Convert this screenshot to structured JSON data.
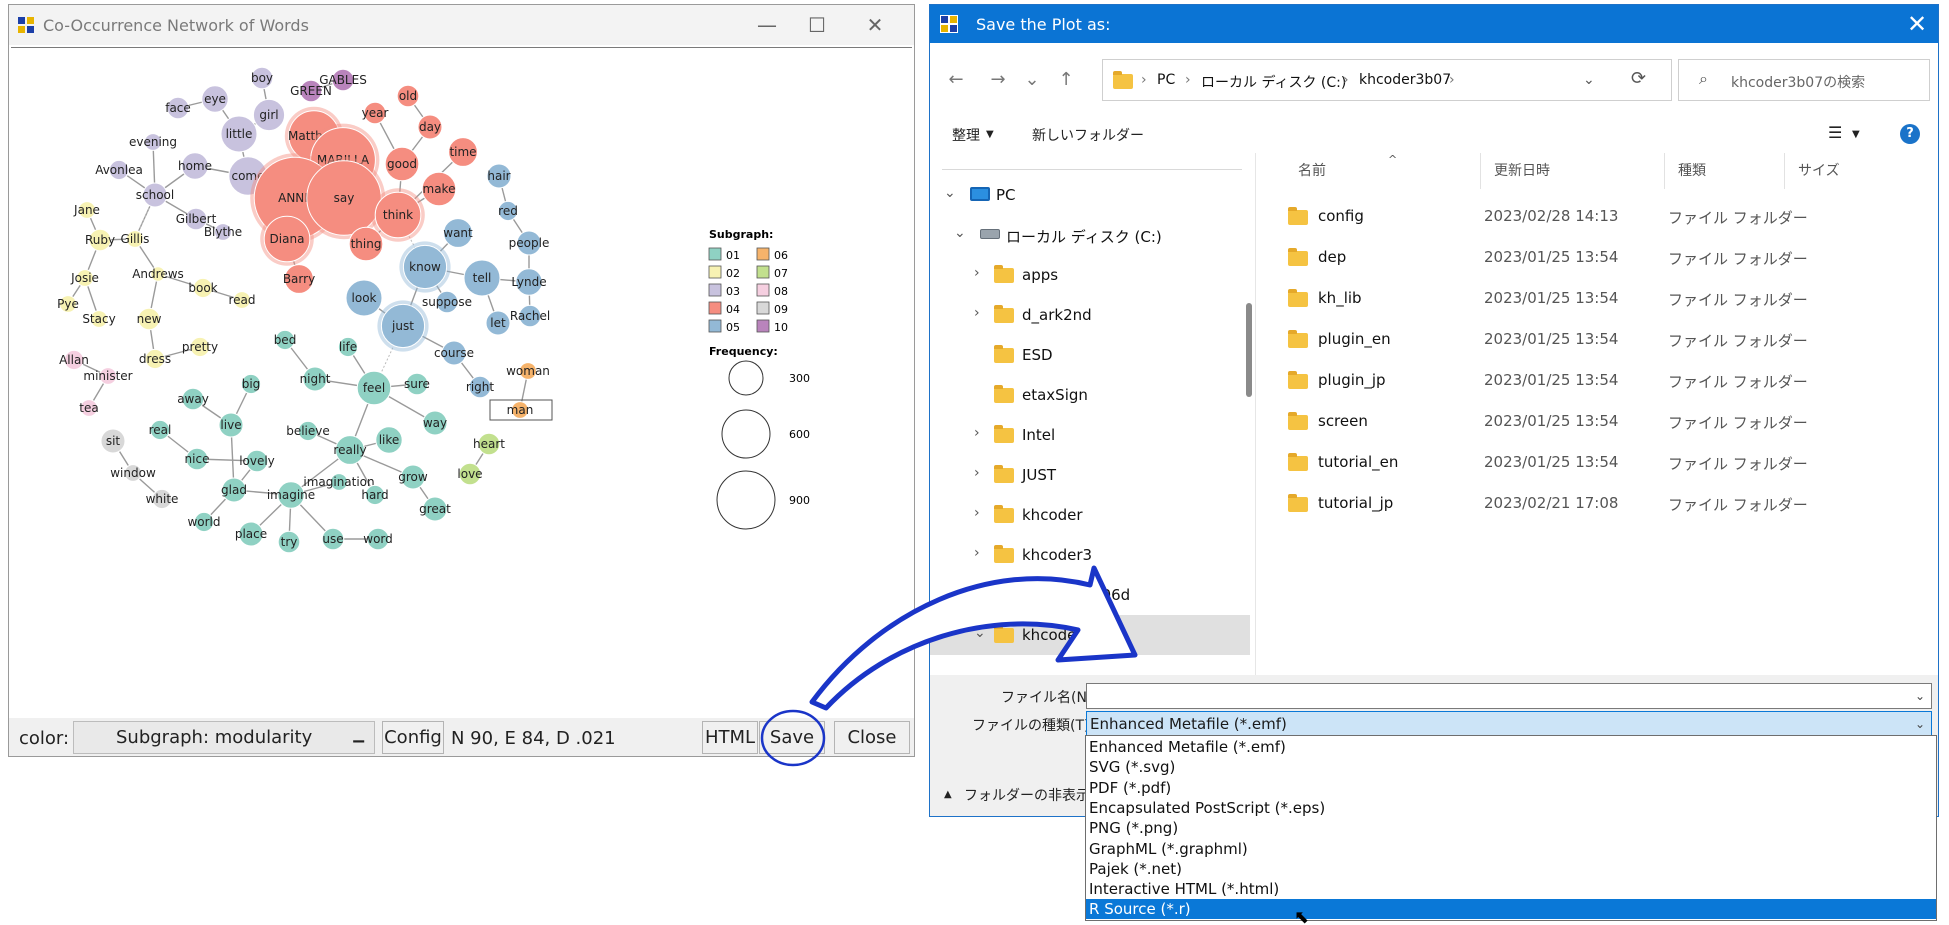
{
  "network_window": {
    "title": "Co-Occurrence Network of Words",
    "controls": {
      "minimize": "—",
      "maximize": "☐",
      "close": "✕"
    },
    "legend": {
      "subgraph_title": "Subgraph:",
      "subgraphs": [
        {
          "label": "01",
          "color": "#8fd1c3"
        },
        {
          "label": "02",
          "color": "#f7f2b3"
        },
        {
          "label": "03",
          "color": "#c8c2de"
        },
        {
          "label": "04",
          "color": "#f58d80"
        },
        {
          "label": "05",
          "color": "#93b9d6"
        },
        {
          "label": "06",
          "color": "#f6b36b"
        },
        {
          "label": "07",
          "color": "#c2e08e"
        },
        {
          "label": "08",
          "color": "#f5cfe0"
        },
        {
          "label": "09",
          "color": "#d8d8d8"
        },
        {
          "label": "10",
          "color": "#b984bc"
        }
      ],
      "frequency_title": "Frequency:",
      "frequency_values": [
        "300",
        "600",
        "900"
      ]
    },
    "toolbar": {
      "color_label": "color:",
      "color_select": "Subgraph: modularity",
      "config_label": "Config",
      "stats": "N 90, E 84, D .021",
      "html_label": "HTML",
      "save_label": "Save",
      "close_label": "Close"
    }
  },
  "network": {
    "nodes": [
      {
        "word": "boy",
        "group": 3,
        "size": 9
      },
      {
        "word": "GABLES",
        "group": 10,
        "size": 9
      },
      {
        "word": "GREEN",
        "group": 10,
        "size": 9
      },
      {
        "word": "old",
        "group": 4,
        "size": 9
      },
      {
        "word": "face",
        "group": 3,
        "size": 9
      },
      {
        "word": "eye",
        "group": 3,
        "size": 11
      },
      {
        "word": "girl",
        "group": 3,
        "size": 13
      },
      {
        "word": "year",
        "group": 4,
        "size": 9
      },
      {
        "word": "day",
        "group": 4,
        "size": 10
      },
      {
        "word": "Matthew",
        "group": 4,
        "size": 21
      },
      {
        "word": "little",
        "group": 3,
        "size": 15
      },
      {
        "word": "MARILLA",
        "group": 4,
        "size": 27
      },
      {
        "word": "time",
        "group": 4,
        "size": 12
      },
      {
        "word": "evening",
        "group": 3,
        "size": 7
      },
      {
        "word": "good",
        "group": 4,
        "size": 14
      },
      {
        "word": "home",
        "group": 3,
        "size": 11
      },
      {
        "word": "come",
        "group": 3,
        "size": 16
      },
      {
        "word": "hair",
        "group": 5,
        "size": 10
      },
      {
        "word": "Avonlea",
        "group": 3,
        "size": 8
      },
      {
        "word": "ANNE",
        "group": 4,
        "size": 34
      },
      {
        "word": "say",
        "group": 4,
        "size": 31
      },
      {
        "word": "make",
        "group": 4,
        "size": 14
      },
      {
        "word": "school",
        "group": 3,
        "size": 10
      },
      {
        "word": "red",
        "group": 5,
        "size": 8
      },
      {
        "word": "think",
        "group": 4,
        "size": 19
      },
      {
        "word": "Jane",
        "group": 2,
        "size": 7
      },
      {
        "word": "Gilbert",
        "group": 3,
        "size": 9
      },
      {
        "word": "Blythe",
        "group": 3,
        "size": 7
      },
      {
        "word": "want",
        "group": 5,
        "size": 12
      },
      {
        "word": "Ruby",
        "group": 2,
        "size": 9
      },
      {
        "word": "Gillis",
        "group": 2,
        "size": 7
      },
      {
        "word": "Diana",
        "group": 4,
        "size": 19
      },
      {
        "word": "thing",
        "group": 4,
        "size": 14
      },
      {
        "word": "people",
        "group": 5,
        "size": 10
      },
      {
        "word": "know",
        "group": 5,
        "size": 18
      },
      {
        "word": "Andrews",
        "group": 2,
        "size": 6
      },
      {
        "word": "tell",
        "group": 5,
        "size": 15
      },
      {
        "word": "Josie",
        "group": 2,
        "size": 7
      },
      {
        "word": "Barry",
        "group": 4,
        "size": 12
      },
      {
        "word": "Lynde",
        "group": 5,
        "size": 11
      },
      {
        "word": "book",
        "group": 2,
        "size": 8
      },
      {
        "word": "read",
        "group": 2,
        "size": 7
      },
      {
        "word": "look",
        "group": 5,
        "size": 15
      },
      {
        "word": "suppose",
        "group": 5,
        "size": 9
      },
      {
        "word": "Pye",
        "group": 2,
        "size": 7
      },
      {
        "word": "Stacy",
        "group": 2,
        "size": 7
      },
      {
        "word": "new",
        "group": 2,
        "size": 9
      },
      {
        "word": "Rachel",
        "group": 5,
        "size": 9
      },
      {
        "word": "just",
        "group": 5,
        "size": 18
      },
      {
        "word": "let",
        "group": 5,
        "size": 10
      },
      {
        "word": "bed",
        "group": 1,
        "size": 8
      },
      {
        "word": "life",
        "group": 1,
        "size": 8
      },
      {
        "word": "pretty",
        "group": 2,
        "size": 8
      },
      {
        "word": "course",
        "group": 5,
        "size": 10
      },
      {
        "word": "dress",
        "group": 2,
        "size": 8
      },
      {
        "word": "Allan",
        "group": 8,
        "size": 8
      },
      {
        "word": "woman",
        "group": 6,
        "size": 7
      },
      {
        "word": "minister",
        "group": 8,
        "size": 7
      },
      {
        "word": "night",
        "group": 1,
        "size": 10
      },
      {
        "word": "feel",
        "group": 1,
        "size": 14
      },
      {
        "word": "sure",
        "group": 1,
        "size": 9
      },
      {
        "word": "right",
        "group": 5,
        "size": 9
      },
      {
        "word": "big",
        "group": 1,
        "size": 8
      },
      {
        "word": "away",
        "group": 1,
        "size": 9
      },
      {
        "word": "tea",
        "group": 8,
        "size": 7
      },
      {
        "word": "man",
        "group": 6,
        "size": 7
      },
      {
        "word": "live",
        "group": 1,
        "size": 10
      },
      {
        "word": "way",
        "group": 1,
        "size": 10
      },
      {
        "word": "real",
        "group": 1,
        "size": 8
      },
      {
        "word": "believe",
        "group": 1,
        "size": 8
      },
      {
        "word": "sit",
        "group": 9,
        "size": 10
      },
      {
        "word": "like",
        "group": 1,
        "size": 11
      },
      {
        "word": "heart",
        "group": 7,
        "size": 9
      },
      {
        "word": "really",
        "group": 1,
        "size": 12
      },
      {
        "word": "nice",
        "group": 1,
        "size": 9
      },
      {
        "word": "lovely",
        "group": 1,
        "size": 9
      },
      {
        "word": "window",
        "group": 9,
        "size": 7
      },
      {
        "word": "grow",
        "group": 1,
        "size": 10
      },
      {
        "word": "love",
        "group": 7,
        "size": 9
      },
      {
        "word": "imagination",
        "group": 1,
        "size": 7
      },
      {
        "word": "glad",
        "group": 1,
        "size": 10
      },
      {
        "word": "imagine",
        "group": 1,
        "size": 11
      },
      {
        "word": "hard",
        "group": 1,
        "size": 8
      },
      {
        "word": "white",
        "group": 9,
        "size": 8
      },
      {
        "word": "great",
        "group": 1,
        "size": 10
      },
      {
        "word": "world",
        "group": 1,
        "size": 8
      },
      {
        "word": "place",
        "group": 1,
        "size": 10
      },
      {
        "word": "use",
        "group": 1,
        "size": 9
      },
      {
        "word": "word",
        "group": 1,
        "size": 9
      },
      {
        "word": "try",
        "group": 1,
        "size": 9
      }
    ],
    "edges": [
      [
        "boy",
        "girl"
      ],
      [
        "face",
        "eye"
      ],
      [
        "eye",
        "little"
      ],
      [
        "girl",
        "little"
      ],
      [
        "little",
        "come"
      ],
      [
        "come",
        "home"
      ],
      [
        "home",
        "school"
      ],
      [
        "evening",
        "school"
      ],
      [
        "Avonlea",
        "school"
      ],
      [
        "school",
        "Gilbert"
      ],
      [
        "Gilbert",
        "Blythe"
      ],
      [
        "school",
        "Gillis"
      ],
      [
        "Jane",
        "Ruby"
      ],
      [
        "Ruby",
        "Gillis"
      ],
      [
        "Ruby",
        "Josie"
      ],
      [
        "Josie",
        "Pye"
      ],
      [
        "Josie",
        "Stacy"
      ],
      [
        "Gillis",
        "Andrews"
      ],
      [
        "Andrews",
        "book"
      ],
      [
        "book",
        "read"
      ],
      [
        "Andrews",
        "new"
      ],
      [
        "new",
        "dress"
      ],
      [
        "dress",
        "pretty"
      ],
      [
        "GREEN",
        "GABLES"
      ],
      [
        "Matthew",
        "MARILLA"
      ],
      [
        "MARILLA",
        "say"
      ],
      [
        "ANNE",
        "say"
      ],
      [
        "ANNE",
        "Diana"
      ],
      [
        "Diana",
        "Barry"
      ],
      [
        "say",
        "think"
      ],
      [
        "think",
        "good"
      ],
      [
        "good",
        "day"
      ],
      [
        "day",
        "old"
      ],
      [
        "good",
        "year"
      ],
      [
        "think",
        "time"
      ],
      [
        "think",
        "make"
      ],
      [
        "think",
        "thing"
      ],
      [
        "know",
        "want"
      ],
      [
        "know",
        "tell"
      ],
      [
        "tell",
        "let"
      ],
      [
        "tell",
        "Lynde"
      ],
      [
        "Lynde",
        "people"
      ],
      [
        "people",
        "red"
      ],
      [
        "red",
        "hair"
      ],
      [
        "Lynde",
        "Rachel"
      ],
      [
        "know",
        "suppose"
      ],
      [
        "know",
        "just"
      ],
      [
        "look",
        "just"
      ],
      [
        "just",
        "course"
      ],
      [
        "course",
        "right"
      ],
      [
        "Allan",
        "minister"
      ],
      [
        "minister",
        "tea"
      ],
      [
        "woman",
        "man"
      ],
      [
        "bed",
        "night"
      ],
      [
        "night",
        "feel"
      ],
      [
        "life",
        "feel"
      ],
      [
        "feel",
        "sure"
      ],
      [
        "feel",
        "way"
      ],
      [
        "feel",
        "really"
      ],
      [
        "believe",
        "really"
      ],
      [
        "really",
        "like"
      ],
      [
        "really",
        "grow"
      ],
      [
        "grow",
        "great"
      ],
      [
        "really",
        "hard"
      ],
      [
        "really",
        "imagine"
      ],
      [
        "imagine",
        "imagination"
      ],
      [
        "imagine",
        "use"
      ],
      [
        "use",
        "word"
      ],
      [
        "imagine",
        "try"
      ],
      [
        "imagine",
        "place"
      ],
      [
        "imagine",
        "glad"
      ],
      [
        "glad",
        "world"
      ],
      [
        "glad",
        "live"
      ],
      [
        "live",
        "away"
      ],
      [
        "live",
        "big"
      ],
      [
        "glad",
        "lovely"
      ],
      [
        "nice",
        "real"
      ],
      [
        "nice",
        "lovely"
      ],
      [
        "sit",
        "window"
      ],
      [
        "window",
        "white"
      ],
      [
        "heart",
        "love"
      ]
    ],
    "dashed_edges": [
      [
        "think",
        "know"
      ],
      [
        "just",
        "feel"
      ],
      [
        "Gillis",
        "school"
      ]
    ]
  },
  "save_dialog": {
    "title": "Save the Plot as:",
    "close": "✕",
    "nav": {
      "back": "←",
      "forward": "→",
      "recent": "⌄",
      "up": "↑",
      "refresh": "⟳"
    },
    "path": [
      "PC",
      "ローカル ディスク (C:)",
      "khcoder3b07"
    ],
    "search_placeholder": "khcoder3b07の検索",
    "organize_label": "整理",
    "new_folder_label": "新しいフォルダー",
    "help": "?",
    "tree": [
      {
        "label": "PC",
        "kind": "pc",
        "chevron": "v"
      },
      {
        "label": "ローカル ディスク (C:)",
        "kind": "drive",
        "chevron": "v"
      },
      {
        "label": "apps",
        "kind": "folder",
        "chevron": ">"
      },
      {
        "label": "d_ark2nd",
        "kind": "folder",
        "chevron": ">"
      },
      {
        "label": "ESD",
        "kind": "folder",
        "chevron": ""
      },
      {
        "label": "etaxSign",
        "kind": "folder",
        "chevron": ""
      },
      {
        "label": "Intel",
        "kind": "folder",
        "chevron": ">"
      },
      {
        "label": "JUST",
        "kind": "folder",
        "chevron": ">"
      },
      {
        "label": "khcoder",
        "kind": "folder",
        "chevron": ">"
      },
      {
        "label": "khcoder3",
        "kind": "folder",
        "chevron": ">"
      },
      {
        "label": "khcoder3b06d",
        "kind": "folder",
        "chevron": ">"
      },
      {
        "label": "khcoder3b07",
        "kind": "folder",
        "chevron": "v",
        "selected": true
      }
    ],
    "columns": {
      "name": "名前",
      "modified": "更新日時",
      "type": "種類",
      "size": "サイズ"
    },
    "files": [
      {
        "name": "config",
        "date": "2023/02/28 14:13",
        "type": "ファイル フォルダー"
      },
      {
        "name": "dep",
        "date": "2023/01/25 13:54",
        "type": "ファイル フォルダー"
      },
      {
        "name": "kh_lib",
        "date": "2023/01/25 13:54",
        "type": "ファイル フォルダー"
      },
      {
        "name": "plugin_en",
        "date": "2023/01/25 13:54",
        "type": "ファイル フォルダー"
      },
      {
        "name": "plugin_jp",
        "date": "2023/01/25 13:54",
        "type": "ファイル フォルダー"
      },
      {
        "name": "screen",
        "date": "2023/01/25 13:54",
        "type": "ファイル フォルダー"
      },
      {
        "name": "tutorial_en",
        "date": "2023/01/25 13:54",
        "type": "ファイル フォルダー"
      },
      {
        "name": "tutorial_jp",
        "date": "2023/02/21 17:08",
        "type": "ファイル フォルダー"
      }
    ],
    "filename_label": "ファイル名(N):",
    "filename_value": "",
    "filetype_label": "ファイルの種類(T):",
    "filetype_value": "Enhanced Metafile (*.emf)",
    "hide_folders": "フォルダーの非表示",
    "filetype_options": [
      "Enhanced Metafile (*.emf)",
      "SVG (*.svg)",
      "PDF (*.pdf)",
      "Encapsulated PostScript (*.eps)",
      "PNG (*.png)",
      "GraphML (*.graphml)",
      "Pajek (*.net)",
      "Interactive HTML (*.html)",
      "R Source (*.r)"
    ],
    "selected_option_index": 8
  }
}
